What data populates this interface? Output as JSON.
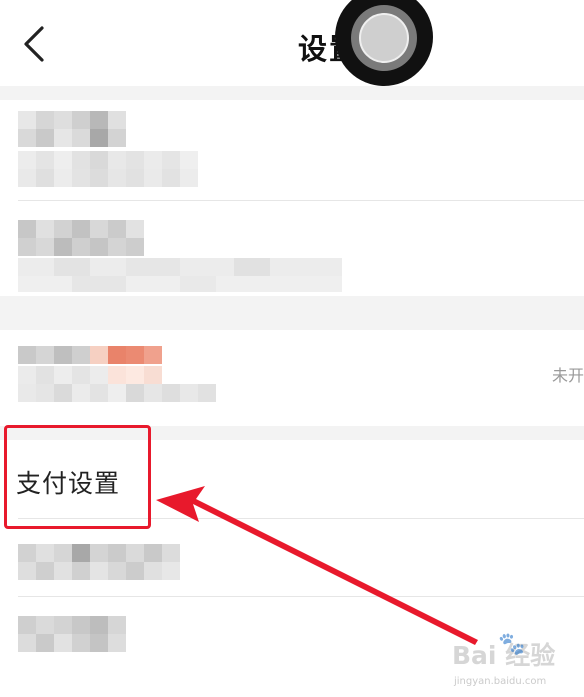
{
  "header": {
    "title": "设置",
    "back_icon": "chevron-left-icon",
    "floating_icon": "assistive-touch-icon"
  },
  "rows": {
    "row3_status": "未开",
    "pay_settings_label": "支付设置"
  },
  "annotation": {
    "box_color": "#e8192c",
    "arrow_color": "#e8192c"
  },
  "watermark": {
    "main": "Bai 经验",
    "sub": "jingyan.baidu.com"
  }
}
